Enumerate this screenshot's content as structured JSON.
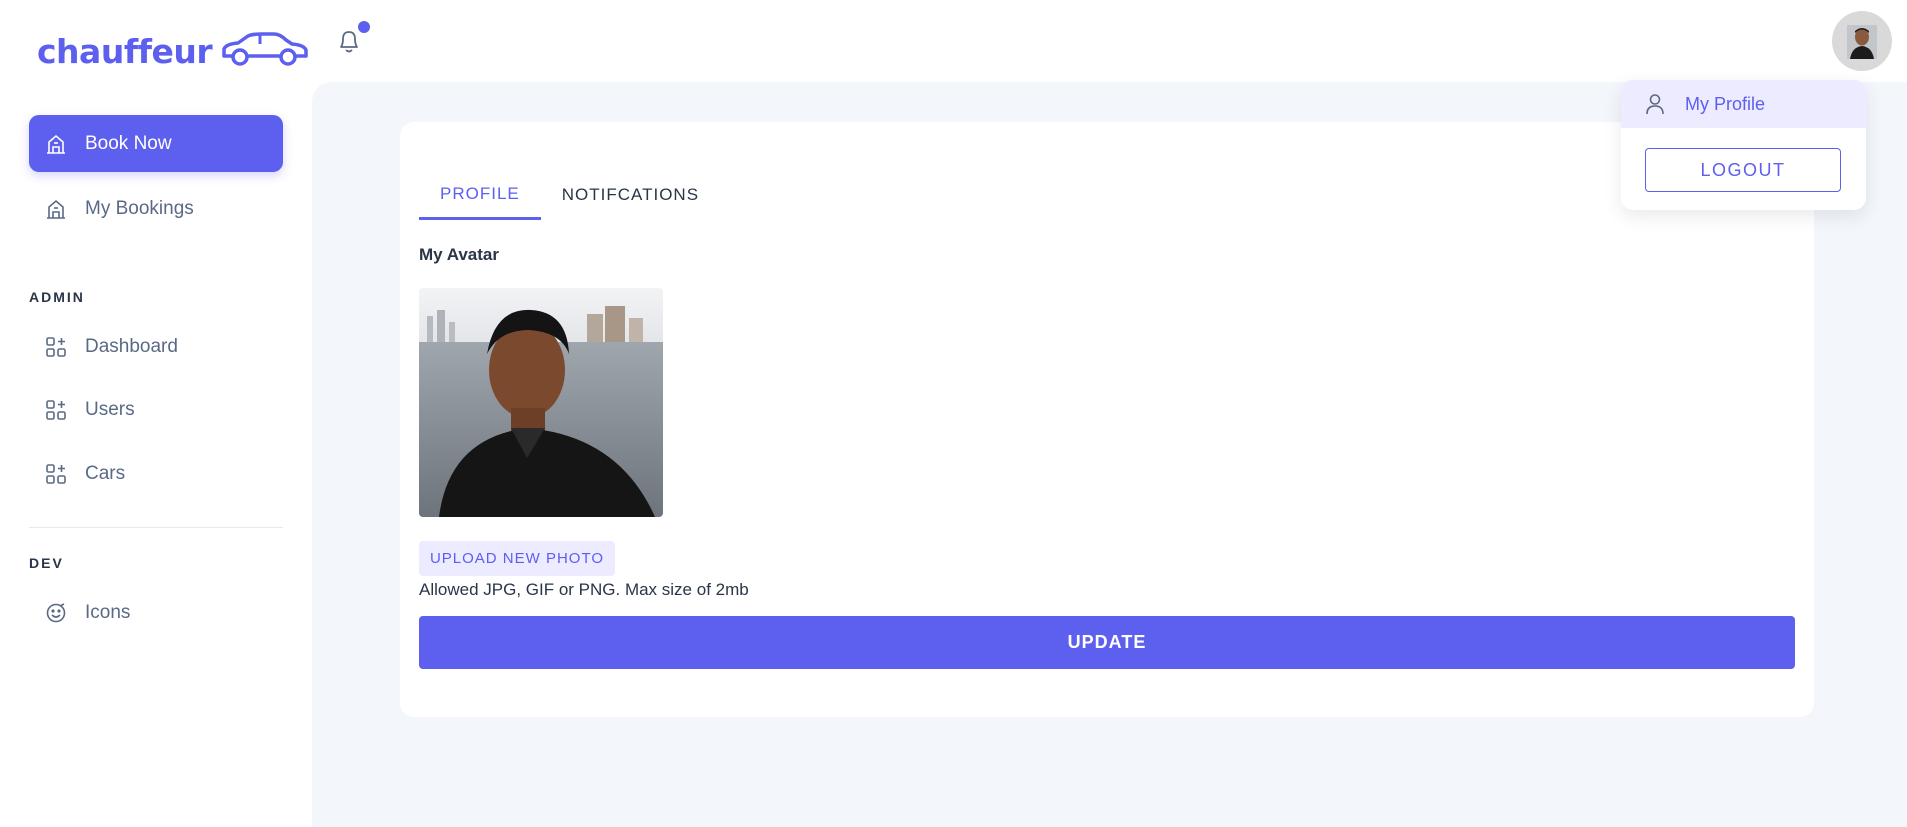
{
  "brand": {
    "name": "chauffeur",
    "logo_icon": "car-icon",
    "accent": "#5d5fef"
  },
  "sidebar": {
    "items": [
      {
        "label": "Book Now",
        "icon": "building-icon",
        "active": true
      },
      {
        "label": "My Bookings",
        "icon": "building-icon",
        "active": false
      }
    ],
    "admin_label": "ADMIN",
    "admin_items": [
      {
        "label": "Dashboard",
        "icon": "apps-icon"
      },
      {
        "label": "Users",
        "icon": "apps-icon"
      },
      {
        "label": "Cars",
        "icon": "apps-icon"
      }
    ],
    "dev_label": "DEV",
    "dev_items": [
      {
        "label": "Icons",
        "icon": "mood-icon"
      }
    ]
  },
  "header": {
    "notification_icon": "bell-icon",
    "has_unread": true
  },
  "profile_menu": {
    "my_profile_label": "My Profile",
    "logout_label": "LOGOUT"
  },
  "tabs": [
    {
      "label": "PROFILE",
      "active": true
    },
    {
      "label": "NOTIFCATIONS",
      "active": false
    }
  ],
  "profile": {
    "avatar_label": "My Avatar",
    "upload_label": "UPLOAD NEW PHOTO",
    "upload_hint": "Allowed JPG, GIF or PNG. Max size of 2mb",
    "update_label": "UPDATE"
  }
}
